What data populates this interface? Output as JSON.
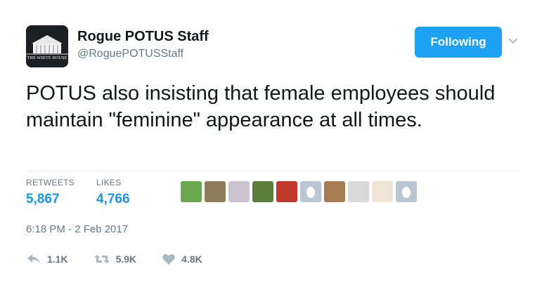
{
  "user": {
    "avatar_text": "THE WHITE HOUSE",
    "name": "Rogue POTUS Staff",
    "handle": "@RoguePOTUSStaff"
  },
  "follow_button": {
    "label": "Following"
  },
  "tweet": {
    "text": "POTUS also insisting that female employees should maintain \"feminine\" appearance at all times."
  },
  "stats": {
    "retweets_label": "RETWEETS",
    "retweets_value": "5,867",
    "likes_label": "LIKES",
    "likes_value": "4,766",
    "liker_avatar_count": 10
  },
  "timestamp": "6:18 PM - 2 Feb 2017",
  "actions": {
    "reply": "1.1K",
    "retweet": "5.9K",
    "like": "4.8K"
  },
  "colors": {
    "accent": "#1da1f2",
    "stat_value": "#1b95e0",
    "muted": "#657786"
  },
  "icons": [
    "white-house-avatar",
    "chevron-down-icon",
    "reply-icon",
    "retweet-icon",
    "heart-icon"
  ]
}
